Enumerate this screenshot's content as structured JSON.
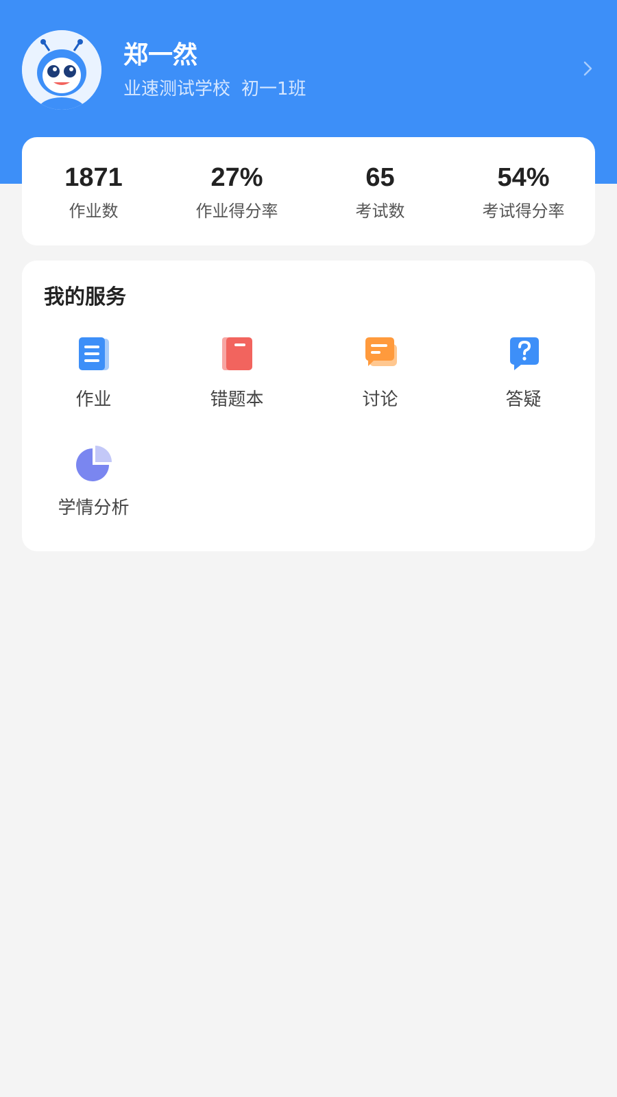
{
  "profile": {
    "name": "郑一然",
    "school": "业速测试学校",
    "class": "初一1班",
    "avatar_icon": "robot-mascot-avatar",
    "chevron_icon": "chevron-right-icon"
  },
  "stats": [
    {
      "value": "1871",
      "label": "作业数"
    },
    {
      "value": "27%",
      "label": "作业得分率"
    },
    {
      "value": "65",
      "label": "考试数"
    },
    {
      "value": "54%",
      "label": "考试得分率"
    }
  ],
  "services": {
    "title": "我的服务",
    "items": [
      {
        "label": "作业",
        "icon": "homework-document-icon",
        "color": "#3d8ff8"
      },
      {
        "label": "错题本",
        "icon": "mistake-book-icon",
        "color": "#f2645e"
      },
      {
        "label": "讨论",
        "icon": "discussion-chat-icon",
        "color": "#ff9a3c"
      },
      {
        "label": "答疑",
        "icon": "question-answer-icon",
        "color": "#3d8ff8"
      },
      {
        "label": "学情分析",
        "icon": "analysis-pie-chart-icon",
        "color": "#7a86f0"
      }
    ]
  },
  "colors": {
    "header_bg": "#3d8ff8",
    "page_bg": "#f4f4f4",
    "card_bg": "#ffffff"
  }
}
